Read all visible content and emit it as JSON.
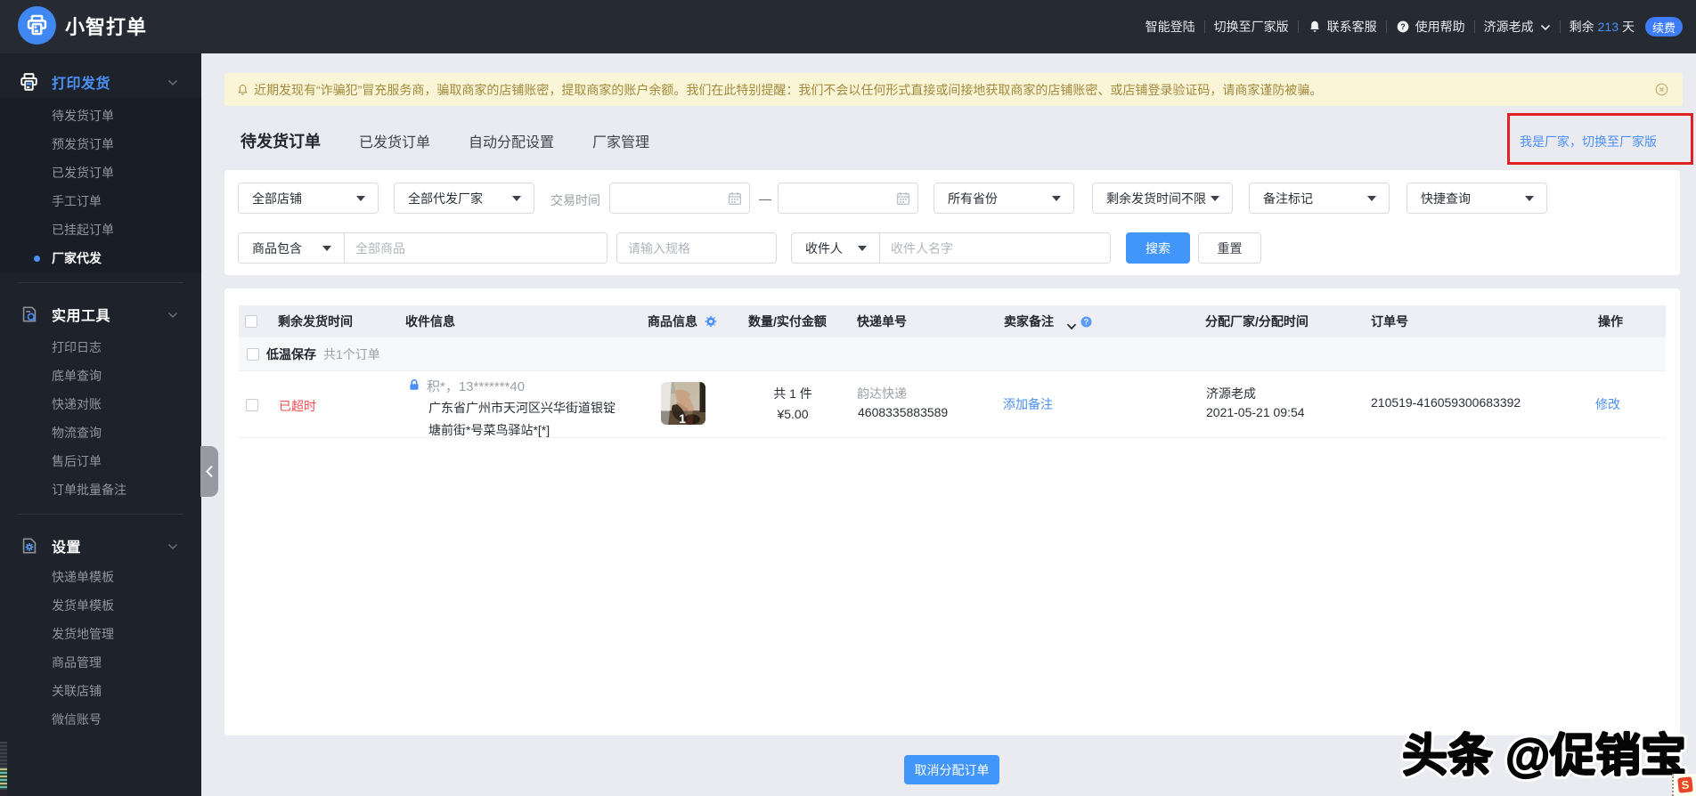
{
  "accent_color": "#4a90f7",
  "topbar": {
    "brand": "小智打单",
    "nav_smart_login": "智能登陆",
    "nav_switch_vendor": "切换至厂家版",
    "nav_contact_service": "联系客服",
    "nav_help": "使用帮助",
    "user_name": "济源老成",
    "remain_prefix": "剩余",
    "remain_days": "213",
    "remain_suffix": "天",
    "renew_label": "续费"
  },
  "sidebar": {
    "groups": [
      {
        "label": "打印发货",
        "items": [
          "待发货订单",
          "预发货订单",
          "已发货订单",
          "手工订单",
          "已挂起订单",
          "厂家代发"
        ]
      },
      {
        "label": "实用工具",
        "items": [
          "打印日志",
          "底单查询",
          "快递对账",
          "物流查询",
          "售后订单",
          "订单批量备注"
        ]
      },
      {
        "label": "设置",
        "items": [
          "快递单模板",
          "发货单模板",
          "发货地管理",
          "商品管理",
          "关联店铺",
          "微信账号"
        ]
      }
    ],
    "active_item": "厂家代发"
  },
  "notice": {
    "text": "近期发现有“诈骗犯”冒充服务商，骗取商家的店铺账密，提取商家的账户余额。我们在此特别提醒：我们不会以任何形式直接或间接地获取商家的店铺账密、或店铺登录验证码，请商家谨防被骗。"
  },
  "tabs": {
    "tab1": "待发货订单",
    "tab2": "已发货订单",
    "tab3": "自动分配设置",
    "tab4": "厂家管理",
    "active": "待发货订单"
  },
  "vendor_link": "我是厂家，切换至厂家版",
  "filters": {
    "shop_select": "全部店铺",
    "vendor_select": "全部代发厂家",
    "trade_time_label": "交易时间",
    "date_separator": "—",
    "province_select": "所有省份",
    "remain_time_select": "剩余发货时间不限",
    "note_mark_select": "备注标记",
    "quick_query_select": "快捷查询",
    "product_contain_select": "商品包含",
    "product_placeholder": "全部商品",
    "spec_placeholder": "请输入规格",
    "receiver_select": "收件人",
    "receiver_placeholder": "收件人名字",
    "search_button": "搜索",
    "reset_button": "重置"
  },
  "table": {
    "columns": {
      "remain_time": "剩余发货时间",
      "receiver_info": "收件信息",
      "product_info": "商品信息",
      "qty_amount": "数量/实付金额",
      "tracking_no": "快递单号",
      "seller_note": "卖家备注",
      "vendor_time": "分配厂家/分配时间",
      "order_no": "订单号",
      "action": "操作"
    },
    "group": {
      "tag": "低温保存",
      "count": "共1个订单"
    },
    "row": {
      "remain_status": "已超时",
      "receiver_name": "积*，13*******40",
      "address_line1": "广东省广州市天河区兴华街道银锭",
      "address_line2": "塘前街*号菜鸟驿站*[*]",
      "product_badge": "1",
      "qty": "共 1 件",
      "amount": "¥5.00",
      "courier": "韵达快递",
      "tracking": "4608335883589",
      "add_note_link": "添加备注",
      "vendor": "济源老成",
      "assign_time": "2021-05-21 09:54",
      "order_no": "210519-416059300683392",
      "action_link": "修改"
    }
  },
  "footer": {
    "cancel_button": "取消分配订单"
  },
  "watermark": "头条 @促销宝"
}
